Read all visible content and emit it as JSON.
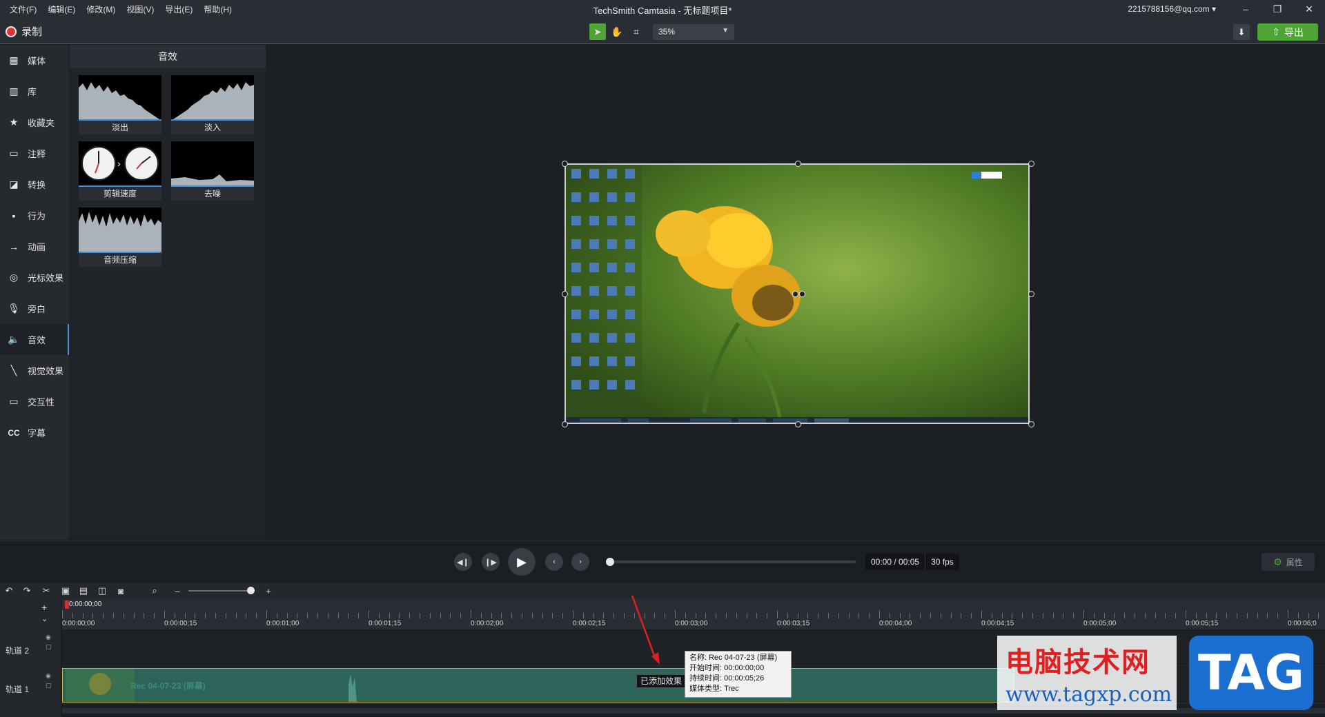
{
  "menu": {
    "items": [
      "文件(F)",
      "编辑(E)",
      "修改(M)",
      "视图(V)",
      "导出(E)",
      "帮助(H)"
    ],
    "title": "TechSmith Camtasia - 无标题项目*",
    "account": "2215788156@qq.com"
  },
  "toolbar": {
    "record_label": "录制",
    "zoom": "35%",
    "export_label": "导出"
  },
  "sidebar": {
    "items": [
      {
        "label": "媒体",
        "icon": "film-icon"
      },
      {
        "label": "库",
        "icon": "library-icon"
      },
      {
        "label": "收藏夹",
        "icon": "star-icon"
      },
      {
        "label": "注释",
        "icon": "annotation-icon"
      },
      {
        "label": "转换",
        "icon": "transition-icon"
      },
      {
        "label": "行为",
        "icon": "behavior-icon"
      },
      {
        "label": "动画",
        "icon": "animation-icon"
      },
      {
        "label": "光标效果",
        "icon": "cursor-icon"
      },
      {
        "label": "旁白",
        "icon": "microphone-icon"
      },
      {
        "label": "音效",
        "icon": "speaker-icon"
      },
      {
        "label": "视觉效果",
        "icon": "wand-icon"
      },
      {
        "label": "交互性",
        "icon": "interactive-icon"
      },
      {
        "label": "字幕",
        "icon": "cc-icon"
      }
    ],
    "active_index": 9
  },
  "panel": {
    "title": "音效",
    "effects": [
      {
        "label": "淡出"
      },
      {
        "label": "淡入"
      },
      {
        "label": "剪辑速度"
      },
      {
        "label": "去噪"
      },
      {
        "label": "音频压缩"
      }
    ]
  },
  "playback": {
    "time": "00:00 / 00:05",
    "fps": "30 fps",
    "props_label": "属性"
  },
  "timeline": {
    "playhead_time": "0:00:00;00",
    "ruler_labels": [
      "0:00:00;00",
      "0:00:00;15",
      "0:00:01;00",
      "0:00:01;15",
      "0:00:02;00",
      "0:00:02;15",
      "0:00:03;00",
      "0:00:03;15",
      "0:00:04;00",
      "0:00:04;15",
      "0:00:05;00",
      "0:00:05;15",
      "0:00:06;0"
    ],
    "tracks": [
      "轨道 2",
      "轨道 1"
    ],
    "clip_label": "Rec 04-07-23 (屏幕)",
    "added_effect": "已添加效果",
    "tooltip": {
      "name": "名称: Rec 04-07-23 (屏幕)",
      "start": "开始时间: 00:00:00;00",
      "duration": "持续时间:    00:00:05;26",
      "type": "媒体类型: Trec"
    }
  },
  "watermark": {
    "text1": "电脑技术网",
    "text2": "www.tagxp.com",
    "tag": "TAG"
  }
}
